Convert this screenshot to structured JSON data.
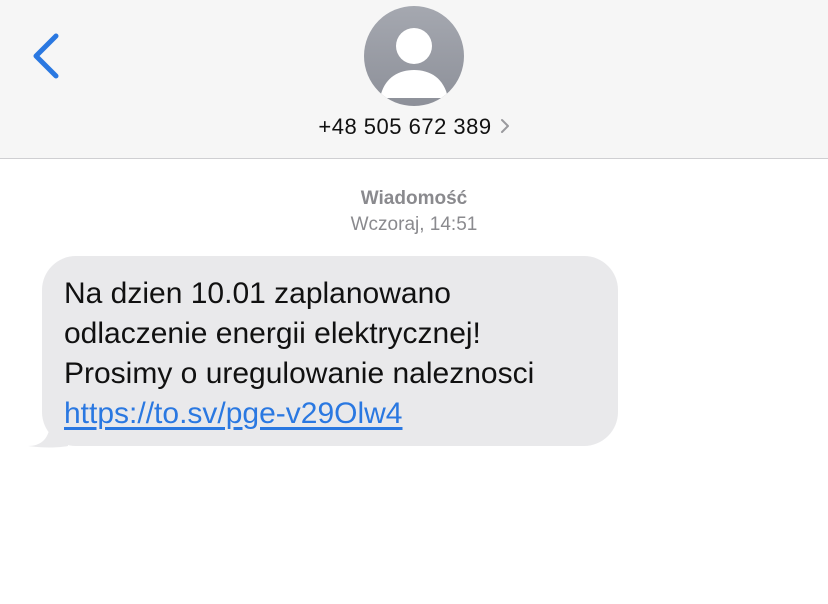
{
  "header": {
    "contact_number": "+48 505 672 389",
    "back_icon": "chevron-left-icon",
    "avatar_icon": "person-silhouette-icon",
    "info_icon": "chevron-right-icon"
  },
  "conversation": {
    "service_label": "Wiadomość",
    "timestamp": "Wczoraj, 14:51",
    "message": {
      "lines": [
        "Na dzien 10.01 zaplanowano",
        "odlaczenie energii elektrycznej!",
        "Prosimy o uregulowanie naleznosci"
      ],
      "link": "https://to.sv/pge-v29Olw4"
    }
  },
  "colors": {
    "accent": "#2a78e1",
    "header_bg": "#f6f6f6",
    "bubble_bg": "#e9e9eb",
    "meta_text": "#8a8a8e"
  }
}
